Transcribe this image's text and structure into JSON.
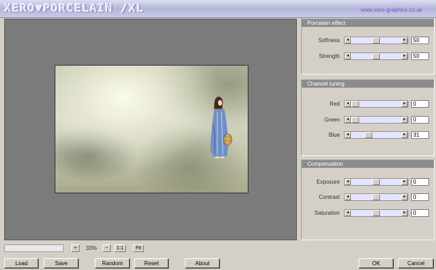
{
  "header": {
    "logo_text": "XERO▼PORCELAIN /XL",
    "url": "www.xero-graphics.co.uk"
  },
  "panels": {
    "porcelain": {
      "title": "Porcelain effect",
      "sliders": [
        {
          "label": "Softness",
          "value": "50",
          "fraction": 0.5
        },
        {
          "label": "Strength",
          "value": "50",
          "fraction": 0.5
        }
      ]
    },
    "channel": {
      "title": "Channel tuning",
      "sliders": [
        {
          "label": "Red",
          "value": "0",
          "fraction": 0.0
        },
        {
          "label": "Green",
          "value": "0",
          "fraction": 0.0
        },
        {
          "label": "Blue",
          "value": "31",
          "fraction": 0.31
        }
      ]
    },
    "compensation": {
      "title": "Compensation",
      "sliders": [
        {
          "label": "Exposure",
          "value": "0",
          "fraction": 0.5
        },
        {
          "label": "Contrast",
          "value": "0",
          "fraction": 0.5
        },
        {
          "label": "Saturation",
          "value": "0",
          "fraction": 0.5
        }
      ]
    }
  },
  "zoom": {
    "plus": "+",
    "value": "33%",
    "minus": "−",
    "one_to_one": "1:1",
    "fit": "Fit"
  },
  "buttons": {
    "load": "Load",
    "save": "Save",
    "random": "Random",
    "reset": "Reset",
    "about": "About",
    "ok": "OK",
    "cancel": "Cancel"
  },
  "icons": {
    "left_arrow": "left-arrow-icon",
    "right_arrow": "right-arrow-icon"
  }
}
